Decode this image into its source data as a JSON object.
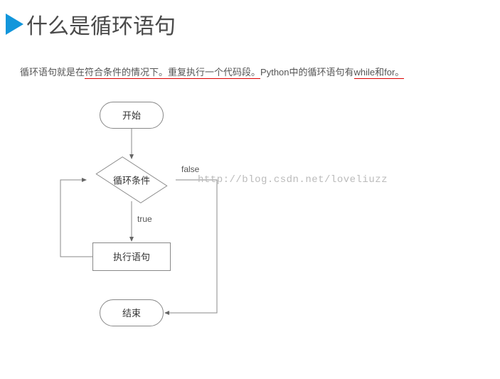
{
  "header": {
    "title": "什么是循环语句"
  },
  "description": {
    "prefix": "循环语句就是在",
    "seg1_ul": "符合条件的情况下。重复执行一个代码段。",
    "mid": "Python中的循环语句有",
    "seg2_ul": "while和for。"
  },
  "flow": {
    "start": "开始",
    "condition": "循环条件",
    "body": "执行语句",
    "end": "结束",
    "false_label": "false",
    "true_label": "true"
  },
  "watermark": "http://blog.csdn.net/loveliuzz"
}
